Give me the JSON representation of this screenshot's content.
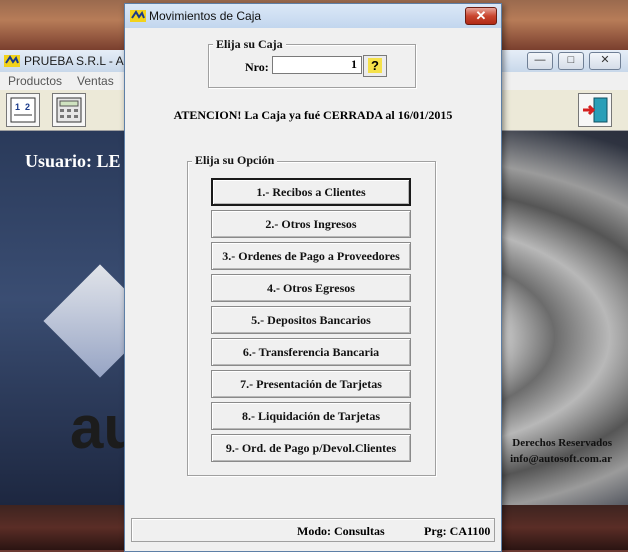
{
  "app": {
    "title": "PRUEBA S.R.L - Aut",
    "menu": [
      "Productos",
      "Ventas"
    ],
    "user_label": "Usuario: LE",
    "logo_text": "au",
    "rights_line1": "Derechos Reservados",
    "rights_line2": "info@autosoft.com.ar"
  },
  "dialog": {
    "title": "Movimientos de Caja",
    "close_symbol": "✕",
    "caja_group_label": "Elija su Caja",
    "nro_label": "Nro:",
    "nro_value": "1",
    "help_symbol": "?",
    "notice": "ATENCION! La Caja ya fué CERRADA al 16/01/2015",
    "options_group_label": "Elija su Opción",
    "options": [
      "1.- Recibos a Clientes",
      "2.- Otros Ingresos",
      "3.- Ordenes de Pago a Proveedores",
      "4.- Otros Egresos",
      "5.- Depositos Bancarios",
      "6.- Transferencia Bancaria",
      "7.- Presentación de Tarjetas",
      "8.- Liquidación de Tarjetas",
      "9.- Ord. de Pago p/Devol.Clientes"
    ],
    "status_mode": "Modo: Consultas",
    "status_prg": "Prg: CA1100"
  },
  "colors": {
    "dialog_bg": "#f0f0f0",
    "close_button": "#c9452f",
    "title_gradient": "#c2d6ee"
  }
}
